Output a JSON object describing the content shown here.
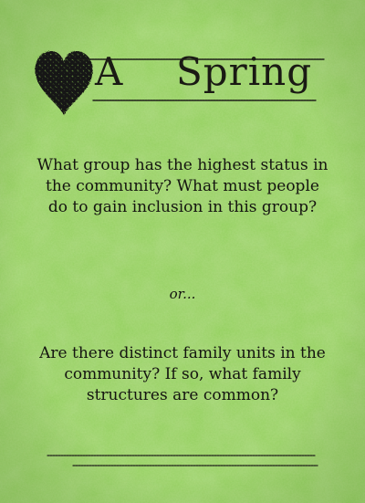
{
  "card": {
    "title_letter": "A",
    "title_word": "Spring",
    "suit_icon": "heart-icon",
    "prompt_primary": "What group has the highest status in the community? What must people do to gain inclusion in this group?",
    "separator": "or...",
    "prompt_alternate": "Are there distinct family units in the community? If so, what family structures are common?"
  },
  "colors": {
    "background": "#93cf5e",
    "ink": "#141410"
  }
}
